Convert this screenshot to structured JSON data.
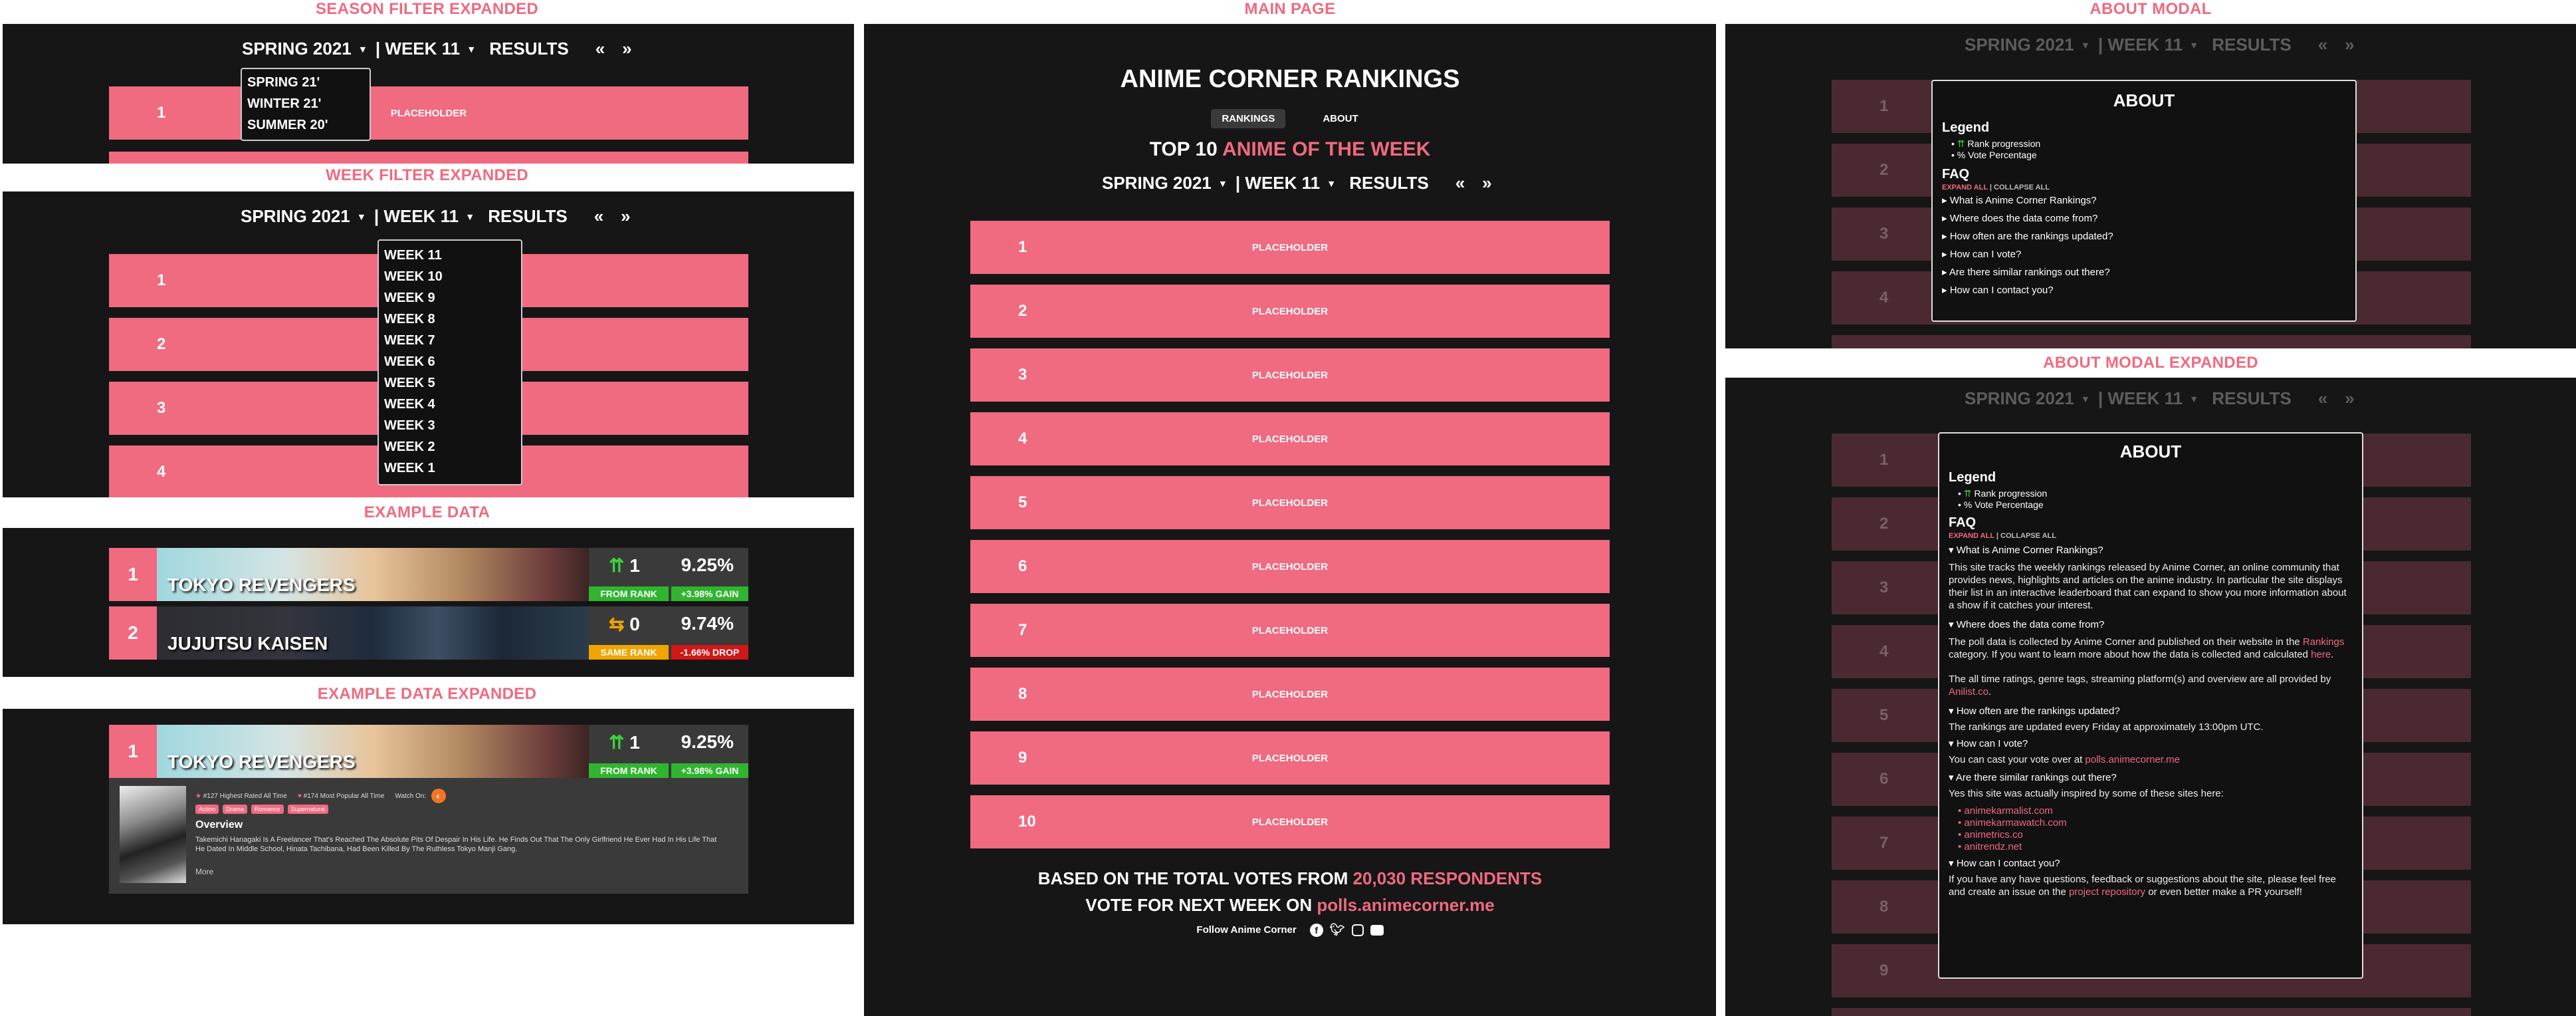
{
  "titles": {
    "season_filter": "SEASON FILTER EXPANDED",
    "week_filter": "WEEK FILTER EXPANDED",
    "example_data": "EXAMPLE DATA",
    "example_expanded": "EXAMPLE DATA EXPANDED",
    "main_page": "MAIN PAGE",
    "about_modal": "ABOUT MODAL",
    "about_expanded": "ABOUT MODAL EXPANDED"
  },
  "nav": {
    "season": "SPRING 2021",
    "week": "| WEEK 11",
    "results": "RESULTS",
    "prev": "«",
    "next": "»"
  },
  "season_options": [
    "SPRING 21'",
    "WINTER 21'",
    "SUMMER 20'"
  ],
  "week_options": [
    "WEEK 11",
    "WEEK 10",
    "WEEK 9",
    "WEEK 8",
    "WEEK 7",
    "WEEK 6",
    "WEEK 5",
    "WEEK 4",
    "WEEK 3",
    "WEEK 2",
    "WEEK 1"
  ],
  "placeholder": "PLACEHOLDER",
  "ranks": [
    "1",
    "2",
    "3",
    "4",
    "5",
    "6",
    "7",
    "8",
    "9",
    "10"
  ],
  "main": {
    "title": "ANIME CORNER RANKINGS",
    "tab_rankings": "RANKINGS",
    "tab_about": "ABOUT",
    "subtitle_prefix": "TOP 10",
    "subtitle_highlight": "ANIME OF THE WEEK",
    "votes_prefix": "BASED ON THE TOTAL VOTES FROM",
    "votes_highlight": "20,030 RESPONDENTS",
    "vote_next_prefix": "VOTE FOR NEXT WEEK ON",
    "vote_next_link": "polls.animecorner.me",
    "follow": "Follow Anime Corner"
  },
  "examples": [
    {
      "rank": "1",
      "title": "TOKYO REVENGERS",
      "rank_value": "1",
      "pct": "9.25%",
      "rank_badge": "FROM RANK",
      "gain_badge": "+3.98% GAIN",
      "rank_color": "#2fb52f",
      "gain_color": "#2fb52f",
      "arrow": "⇈"
    },
    {
      "rank": "2",
      "title": "JUJUTSU KAISEN",
      "rank_value": "0",
      "pct": "9.74%",
      "rank_badge": "SAME RANK",
      "gain_badge": "-1.66% DROP",
      "rank_color": "#f0a500",
      "gain_color": "#d01818",
      "arrow": "⇆"
    }
  ],
  "expanded": {
    "rated": "#127 Highest Rated All Time",
    "popular": "#174 Most Popular All Time",
    "watch_on": "Watch On:",
    "tags": [
      "Action",
      "Drama",
      "Romance",
      "Supernatural"
    ],
    "overview_title": "Overview",
    "overview": "Takemichi Hanagaki Is A Freelancer That's Reached The Absolute Pits Of Despair In His Life. He Finds Out That The Only Girlfriend He Ever Had In His Life That He Dated In Middle School, Hinata Tachibana, Had Been Killed By The Ruthless Tokyo Manji Gang.",
    "more": "More"
  },
  "about": {
    "title": "ABOUT",
    "legend": "Legend",
    "legend_rank": "Rank progression",
    "legend_vote": "% Vote Percentage",
    "faq": "FAQ",
    "expand_all": "EXPAND ALL",
    "collapse_all": "| COLLAPSE ALL",
    "questions": [
      "What is Anime Corner Rankings?",
      "Where does the data come from?",
      "How often are the rankings updated?",
      "How can I vote?",
      "Are there similar rankings out there?",
      "How can I contact you?"
    ],
    "a1": "This site tracks the weekly rankings released by Anime Corner, an online community that provides news, highlights and articles on the anime industry. In particular the site displays their list in an interactive leaderboard that can expand to show you more information about a show if it catches your interest.",
    "a2_pre": "The poll data is collected by Anime Corner and published on their website in the",
    "a2_link": "Rankings",
    "a2_mid": "category. If you want to learn more about how the data is collected and calculated",
    "a2_here": "here",
    "a2_post": ".",
    "a2b_pre": "The all time ratings, genre tags, streaming platform(s) and overview are all provided by",
    "a2b_link": "Anilist.co",
    "a2b_post": ".",
    "a3": "The rankings are updated every Friday at approximately 13:00pm UTC.",
    "a4_pre": "You can cast your vote over at",
    "a4_link": "polls.animecorner.me",
    "a5": "Yes this site was actually inspired by some of these sites here:",
    "a5_links": [
      "animekarmalist.com",
      "animekarmawatch.com",
      "animetrics.co",
      "anitrendz.net"
    ],
    "a6_pre": "If you have any have questions, feedback or suggestions about the site, please feel free and create an issue on the",
    "a6_link": "project repository",
    "a6_post": "or even better make a PR yourself!"
  },
  "colors": {
    "accent": "#f06a80",
    "bg": "#161616",
    "green": "#2fb52f",
    "orange": "#f0a500",
    "red": "#d01818"
  }
}
